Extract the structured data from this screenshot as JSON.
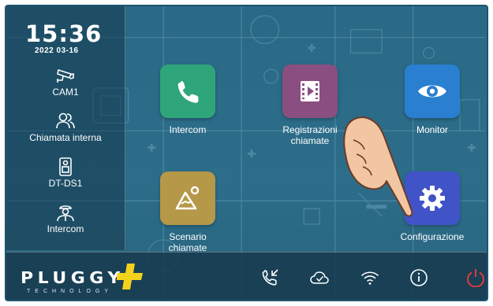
{
  "clock": {
    "time": "15:36",
    "date": "2022 03-16"
  },
  "sidebar": {
    "items": [
      {
        "label": "CAM1",
        "icon": "cctv-camera-icon"
      },
      {
        "label": "Chiamata interna",
        "icon": "users-icon"
      },
      {
        "label": "DT-DS1",
        "icon": "door-station-icon"
      },
      {
        "label": "Intercom",
        "icon": "guard-icon"
      }
    ]
  },
  "apps": [
    {
      "label": "Intercom",
      "icon": "phone-icon",
      "color": "#2fa57a"
    },
    {
      "label": "Registrazioni\nchiamate",
      "icon": "video-record-icon",
      "color": "#8b4e80"
    },
    {
      "label": "Monitor",
      "icon": "eye-icon",
      "color": "#2a7fd1"
    },
    {
      "label": "Scenario\nchiamate",
      "icon": "scenario-icon",
      "color": "#b59848"
    },
    {
      "label": "Configurazione",
      "icon": "gear-icon",
      "color": "#4054c8"
    }
  ],
  "bottombar": {
    "logo_text": "PLUGGY",
    "logo_sub": "TECHNOLOGY",
    "icons": [
      "call-log-icon",
      "cloud-icon",
      "wifi-icon",
      "info-icon",
      "power-icon"
    ]
  },
  "colors": {
    "screen_bg": "#2c6d89",
    "accent_yellow": "#f2d21b",
    "power_red": "#e23b3b"
  }
}
